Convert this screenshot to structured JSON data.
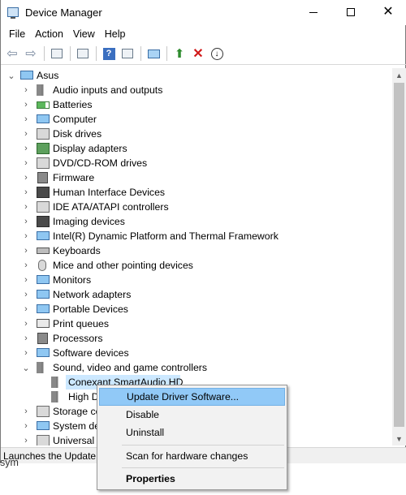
{
  "window": {
    "title": "Device Manager",
    "controls": {
      "minimize": "—",
      "maximize": "☐",
      "close": "✕"
    }
  },
  "menu": [
    "File",
    "Action",
    "View",
    "Help"
  ],
  "toolbar": {
    "icons": [
      "back-arrow-icon",
      "forward-arrow-icon",
      "properties-icon",
      "update-icon",
      "help-icon",
      "show-hidden-icon",
      "scan-monitor-icon",
      "enable-device-icon",
      "uninstall-x-icon",
      "download-driver-icon"
    ],
    "glyphs": {
      "back": "⇦",
      "forward": "⇨",
      "help": "?",
      "enable": "⬆",
      "uninstall": "✕",
      "download": "↓"
    }
  },
  "tree": {
    "root": "Asus",
    "categories": [
      "Audio inputs and outputs",
      "Batteries",
      "Computer",
      "Disk drives",
      "Display adapters",
      "DVD/CD-ROM drives",
      "Firmware",
      "Human Interface Devices",
      "IDE ATA/ATAPI controllers",
      "Imaging devices",
      "Intel(R) Dynamic Platform and Thermal Framework",
      "Keyboards",
      "Mice and other pointing devices",
      "Monitors",
      "Network adapters",
      "Portable Devices",
      "Print queues",
      "Processors",
      "Software devices",
      "Sound, video and game controllers"
    ],
    "expanded_children": [
      "Conexant SmartAudio HD",
      "High D"
    ],
    "after": [
      "Storage co",
      "System dev",
      "Universal S"
    ],
    "expander_collapsed": "›",
    "expander_expanded": "⌄"
  },
  "context_menu": {
    "items": [
      "Update Driver Software...",
      "Disable",
      "Uninstall",
      "Scan for hardware changes",
      "Properties"
    ],
    "highlighted": "Update Driver Software..."
  },
  "status_bar": {
    "text": "Launches the Update D"
  },
  "below_text": "sym",
  "scrollbar": {
    "up": "▲",
    "down": "▼"
  }
}
